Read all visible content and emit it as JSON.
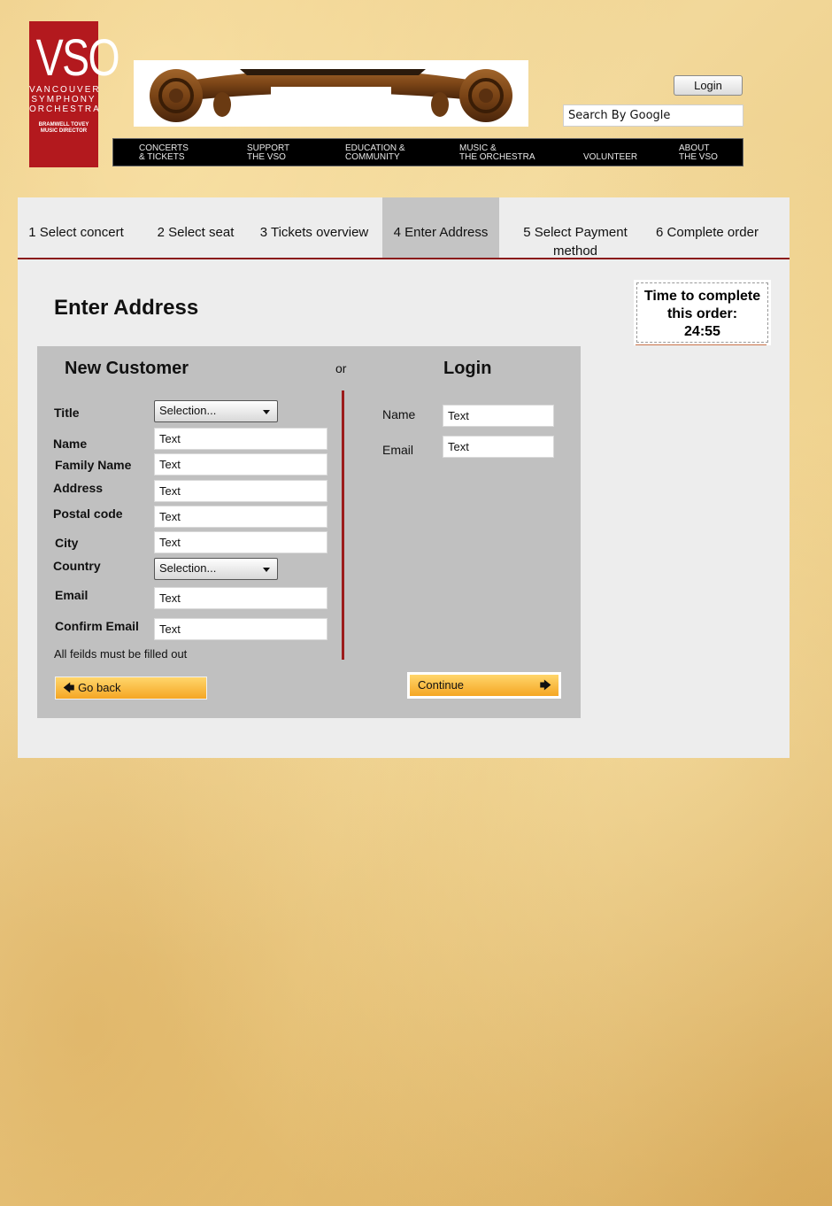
{
  "header": {
    "logo": {
      "mark": "VSO",
      "lines": [
        "VANCOUVER",
        "SYMPHONY",
        "ORCHESTRA"
      ],
      "director": [
        "BRAMWELL TOVEY",
        "MUSIC DIRECTOR"
      ]
    },
    "login_label": "Login",
    "search_placeholder": "Search By Google",
    "nav": [
      {
        "line1": "Concerts",
        "line2": "& Tickets"
      },
      {
        "line1": "Support",
        "line2": "The VSO"
      },
      {
        "line1": "Education &",
        "line2": "Community"
      },
      {
        "line1": "Music &",
        "line2": "The Orchestra"
      },
      {
        "line1": "",
        "line2": "Volunteer"
      },
      {
        "line1": "About",
        "line2": "The VSO"
      }
    ]
  },
  "steps": [
    {
      "label": "1 Select concert"
    },
    {
      "label": "2 Select seat"
    },
    {
      "label": "3 Tickets overview"
    },
    {
      "label": "4 Enter Address",
      "active": true
    },
    {
      "label": "5 Select Payment method"
    },
    {
      "label": "6 Complete order"
    }
  ],
  "page_title": "Enter Address",
  "timer": {
    "label": "Time to complete this order:",
    "value": "24:55"
  },
  "new_customer": {
    "heading": "New Customer",
    "fields": {
      "title": {
        "label": "Title",
        "value": "Selection..."
      },
      "name": {
        "label": "Name",
        "value": "Text"
      },
      "family_name": {
        "label": "Family Name",
        "value": "Text"
      },
      "address": {
        "label": "Address",
        "value": "Text"
      },
      "postal_code": {
        "label": "Postal code",
        "value": "Text"
      },
      "city": {
        "label": "City",
        "value": "Text"
      },
      "country": {
        "label": "Country",
        "value": "Selection..."
      },
      "email": {
        "label": "Email",
        "value": "Text"
      },
      "confirm_email": {
        "label": "Confirm Email",
        "value": "Text"
      }
    },
    "note": "All feilds must be filled out",
    "go_back_label": "Go back"
  },
  "or_label": "or",
  "login": {
    "heading": "Login",
    "name": {
      "label": "Name",
      "value": "Text"
    },
    "email": {
      "label": "Email",
      "value": "Text"
    },
    "continue_label": "Continue"
  },
  "colors": {
    "brand_red": "#b3191e",
    "accent_orange": "#f5a623",
    "panel": "#ededed",
    "form_box": "#c0c0c0"
  }
}
